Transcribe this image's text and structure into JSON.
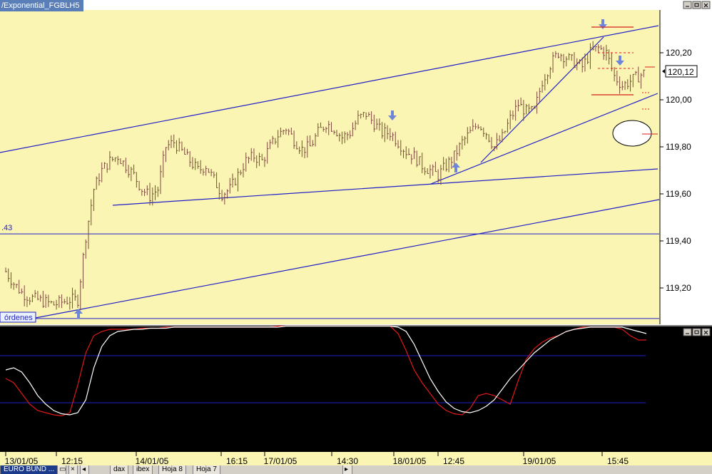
{
  "window": {
    "title": "/Exponential_FGBLH5",
    "window_controls": [
      "minimize-icon",
      "restore-icon",
      "close-icon"
    ]
  },
  "price_panel": {
    "y_ticks": [
      "120,20",
      "120,00",
      "119,80",
      "119,60",
      "119,40",
      "119,20"
    ],
    "current_price": "120,12",
    "horizontal_line_label": ".43",
    "order_label": "órdenes"
  },
  "x_labels": [
    "13/01/05",
    "12:15",
    "14/01/05",
    "16:15",
    "17/01/05",
    "14:30",
    "18/01/05",
    "12:45",
    "19/01/05",
    "15:45"
  ],
  "sheet_tabs": [
    "EURO BUND ...",
    "dax",
    "ibex",
    "Hoja 8",
    "Hoja 7"
  ],
  "colors": {
    "price_background": "#fbf5b4",
    "axis_background": "#ffffff",
    "bars": "#7a4a3a",
    "trendlines": "#1f1fc8",
    "arrows": "#6f86d8",
    "red_lines": "#d81e1e",
    "oscillator_background": "#000000",
    "oscillator_fast": "#e01818",
    "oscillator_slow": "#ffffff"
  },
  "chart_data": [
    {
      "type": "line",
      "subtype": "ohlc-bars",
      "title": "/Exponential_FGBLH5",
      "ylim": [
        119.05,
        120.4
      ],
      "y_ticks": [
        120.2,
        120.0,
        119.8,
        119.6,
        119.4,
        119.2
      ],
      "x_tick_labels": [
        "13/01/05",
        "12:15",
        "14/01/05",
        "16:15",
        "17/01/05",
        "14:30",
        "18/01/05",
        "12:45",
        "19/01/05",
        "15:45"
      ],
      "series": [
        {
          "values": [
            119.27,
            119.22,
            119.18,
            119.16,
            119.15,
            119.14,
            119.13,
            119.14,
            119.15,
            119.15,
            119.42,
            119.62,
            119.7,
            119.74,
            119.76,
            119.72,
            119.68,
            119.62,
            119.59,
            119.62,
            119.8,
            119.82,
            119.78,
            119.74,
            119.7,
            119.72,
            119.66,
            119.6,
            119.62,
            119.68,
            119.74,
            119.76,
            119.74,
            119.8,
            119.85,
            119.88,
            119.83,
            119.79,
            119.8,
            119.86,
            119.9,
            119.88,
            119.84,
            119.86,
            119.92,
            119.94,
            119.9,
            119.86,
            119.86,
            119.82,
            119.78,
            119.76,
            119.72,
            119.7,
            119.68,
            119.72,
            119.76,
            119.82,
            119.86,
            119.9,
            119.86,
            119.8,
            119.84,
            119.92,
            119.98,
            119.95,
            119.95,
            120.08,
            120.15,
            120.2,
            120.18,
            120.16,
            120.14,
            120.2,
            120.22,
            120.2,
            120.1,
            120.06,
            120.08,
            120.1,
            120.12
          ]
        }
      ],
      "current_price": 120.12,
      "horizontal_lines": [
        119.43,
        119.07
      ],
      "annotations": [
        "120,12",
        ".43",
        "órdenes"
      ]
    },
    {
      "type": "line",
      "subtype": "oscillator",
      "ylim": [
        0,
        100
      ],
      "guide_levels": [
        80,
        20
      ],
      "series": [
        {
          "color": "#e01818",
          "values": [
            44,
            40,
            30,
            20,
            14,
            12,
            10,
            9,
            12,
            38,
            68,
            84,
            88,
            90,
            90,
            90,
            90,
            91,
            91,
            91,
            92,
            92,
            92,
            92,
            92,
            92,
            92,
            92,
            92,
            92,
            92,
            92,
            92,
            92,
            93,
            93,
            93,
            93,
            93,
            93,
            93,
            93,
            93,
            93,
            93,
            93,
            93,
            93,
            93,
            86,
            70,
            52,
            40,
            30,
            20,
            14,
            11,
            10,
            16,
            28,
            30,
            28,
            24,
            20,
            42,
            62,
            72,
            78,
            82,
            84,
            88,
            90,
            92,
            92,
            92,
            92,
            92,
            90,
            84,
            80,
            80
          ]
        },
        {
          "color": "#ffffff",
          "values": [
            52,
            54,
            50,
            40,
            28,
            20,
            14,
            11,
            10,
            12,
            24,
            54,
            74,
            84,
            88,
            89,
            90,
            90,
            91,
            91,
            91,
            92,
            92,
            92,
            92,
            92,
            92,
            92,
            92,
            92,
            92,
            92,
            92,
            92,
            92,
            93,
            93,
            93,
            93,
            93,
            93,
            93,
            93,
            93,
            93,
            93,
            93,
            93,
            93,
            92,
            88,
            76,
            60,
            44,
            32,
            22,
            16,
            13,
            12,
            14,
            18,
            24,
            34,
            44,
            52,
            60,
            68,
            74,
            80,
            84,
            88,
            90,
            91,
            92,
            92,
            92,
            92,
            92,
            90,
            88,
            86
          ]
        }
      ]
    }
  ]
}
